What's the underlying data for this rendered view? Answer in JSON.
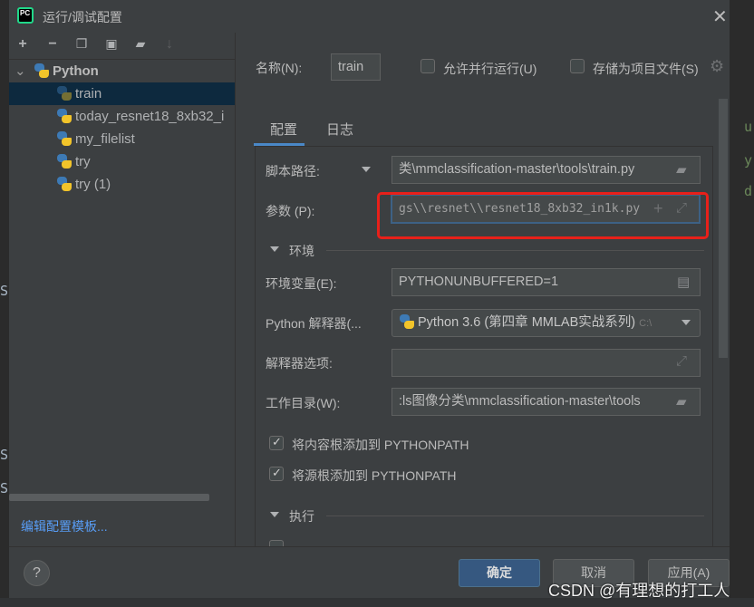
{
  "window": {
    "title": "运行/调试配置",
    "app_icon": "pycharm-logo",
    "close_icon": "close-icon"
  },
  "background_fragments": {
    "left": [
      "S",
      "S",
      "S"
    ],
    "right": [
      "u",
      "y",
      "d"
    ]
  },
  "toolbar": {
    "icons": [
      "add-icon",
      "remove-icon",
      "copy-icon",
      "save-icon",
      "new-folder-icon",
      "sort-icon"
    ]
  },
  "tree": {
    "group": "Python",
    "items": [
      {
        "label": "train",
        "selected": true
      },
      {
        "label": "today_resnet18_8xb32_i",
        "selected": false
      },
      {
        "label": "my_filelist",
        "selected": false
      },
      {
        "label": "try",
        "selected": false
      },
      {
        "label": "try (1)",
        "selected": false
      }
    ]
  },
  "edit_templates_link": "编辑配置模板...",
  "header": {
    "name_label": "名称(N):",
    "name_value": "train",
    "allow_parallel": {
      "label": "允许并行运行(U)",
      "checked": false
    },
    "store_as_file": {
      "label": "存储为项目文件(S)",
      "checked": false
    }
  },
  "tabs": [
    {
      "label": "配置",
      "active": true
    },
    {
      "label": "日志",
      "active": false
    }
  ],
  "form": {
    "script_path": {
      "label": "脚本路径:",
      "value": "类\\mmclassification-master\\tools\\train.py"
    },
    "params": {
      "label": "参数 (P):",
      "value": "gs\\\\resnet\\\\resnet18_8xb32_in1k.py"
    },
    "env_section": "环境",
    "env_vars": {
      "label": "环境变量(E):",
      "value": "PYTHONUNBUFFERED=1"
    },
    "interpreter": {
      "label": "Python 解释器(...",
      "value": "Python 3.6 (第四章 MMLAB实战系列)",
      "suffix": "C:\\"
    },
    "interpreter_options": {
      "label": "解释器选项:",
      "value": ""
    },
    "working_dir": {
      "label": "工作目录(W):",
      "value": ":ls图像分类\\mmclassification-master\\tools"
    },
    "add_content_roots": {
      "label": "将内容根添加到 PYTHONPATH",
      "checked": true
    },
    "add_source_roots": {
      "label": "将源根添加到 PYTHONPATH",
      "checked": true
    },
    "exec_section": "执行"
  },
  "highlight_color": "#e8201a",
  "accent": "#365880",
  "buttons": {
    "help": "?",
    "ok": "确定",
    "cancel": "取消",
    "apply": "应用(A)"
  },
  "watermark": "CSDN @有理想的打工人"
}
